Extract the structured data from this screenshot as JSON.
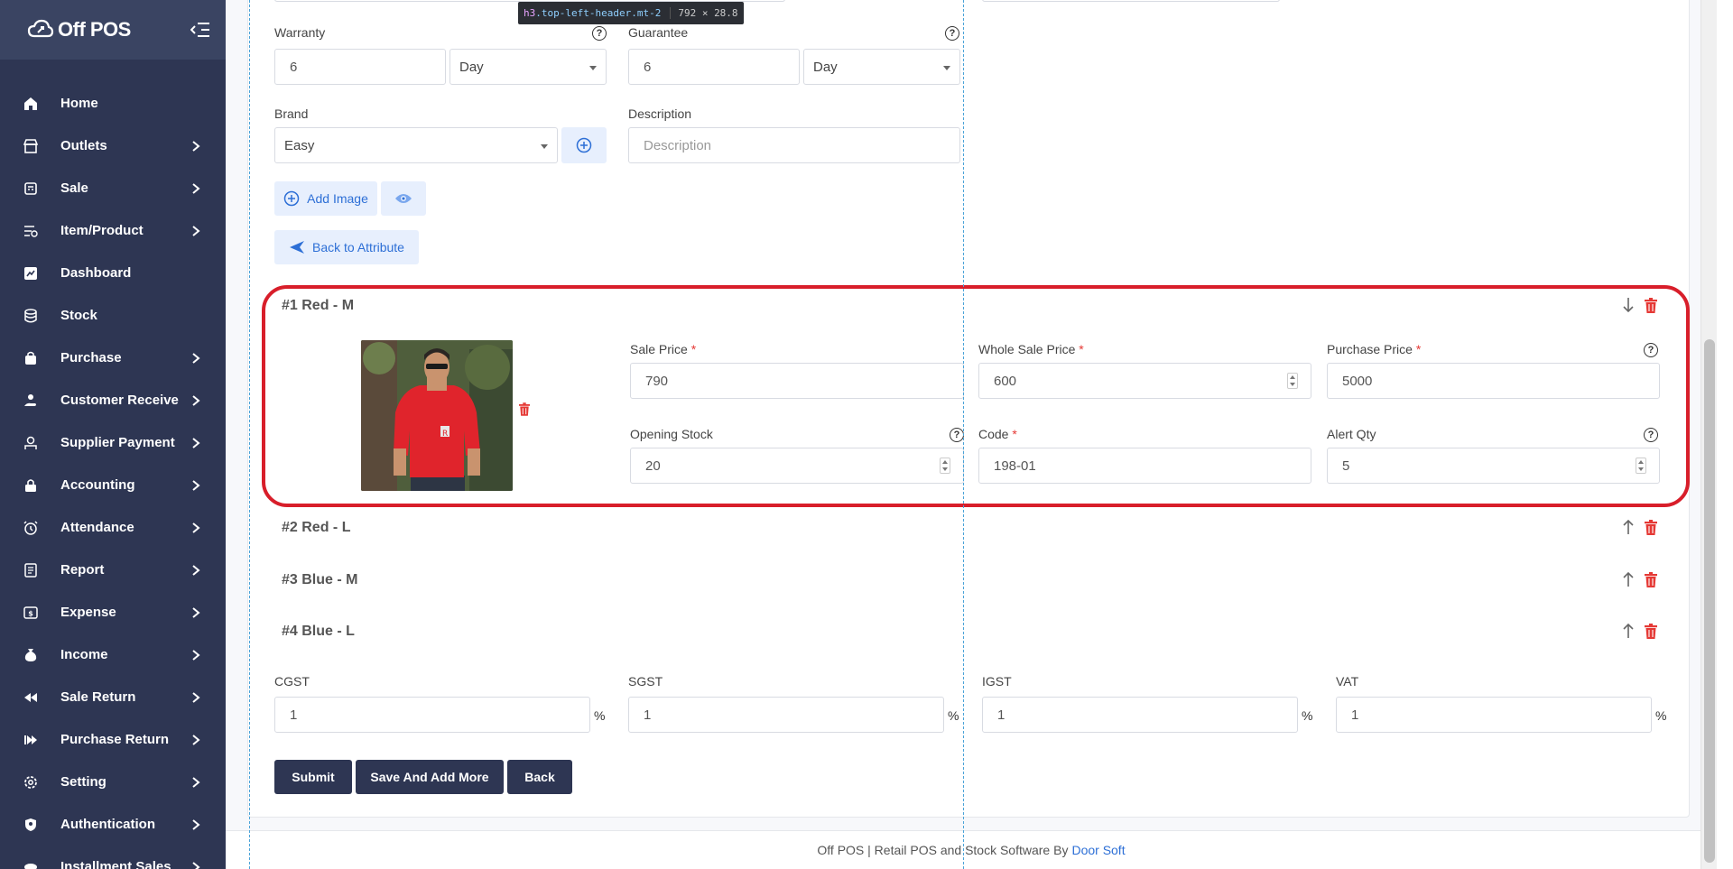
{
  "app": {
    "name": "Off POS"
  },
  "sidebar": {
    "items": [
      {
        "label": "Home",
        "icon": "home-icon",
        "has_children": false
      },
      {
        "label": "Outlets",
        "icon": "store-icon",
        "has_children": true
      },
      {
        "label": "Sale",
        "icon": "register-icon",
        "has_children": true
      },
      {
        "label": "Item/Product",
        "icon": "list-filter-icon",
        "has_children": true
      },
      {
        "label": "Dashboard",
        "icon": "chart-icon",
        "has_children": false
      },
      {
        "label": "Stock",
        "icon": "database-icon",
        "has_children": false
      },
      {
        "label": "Purchase",
        "icon": "bag-icon",
        "has_children": true
      },
      {
        "label": "Customer Receive",
        "icon": "user-hand-icon",
        "has_children": true
      },
      {
        "label": "Supplier Payment",
        "icon": "wallet-icon",
        "has_children": true
      },
      {
        "label": "Accounting",
        "icon": "lock-icon",
        "has_children": true
      },
      {
        "label": "Attendance",
        "icon": "alarm-clock-icon",
        "has_children": true
      },
      {
        "label": "Report",
        "icon": "document-icon",
        "has_children": true
      },
      {
        "label": "Expense",
        "icon": "money-icon",
        "has_children": true
      },
      {
        "label": "Income",
        "icon": "money-bag-icon",
        "has_children": true
      },
      {
        "label": "Sale Return",
        "icon": "rewind-icon",
        "has_children": true
      },
      {
        "label": "Purchase Return",
        "icon": "forward-icon",
        "has_children": true
      },
      {
        "label": "Setting",
        "icon": "gear-icon",
        "has_children": true
      },
      {
        "label": "Authentication",
        "icon": "shield-icon",
        "has_children": true
      },
      {
        "label": "Installment Sales",
        "icon": "layers-icon",
        "has_children": true
      }
    ]
  },
  "devtools": {
    "tag": "h3",
    "classes": ".top-left-header.mt-2",
    "dimensions": "792 × 28.8"
  },
  "form": {
    "warranty": {
      "label": "Warranty",
      "value": "6",
      "unit": "Day"
    },
    "guarantee": {
      "label": "Guarantee",
      "value": "6",
      "unit": "Day"
    },
    "brand": {
      "label": "Brand",
      "value": "Easy"
    },
    "description": {
      "label": "Description",
      "placeholder": "Description"
    },
    "add_image_label": "Add Image",
    "back_to_attribute_label": "Back to Attribute"
  },
  "variants": [
    {
      "title": "#1 Red - M",
      "expanded": true,
      "sale_price": {
        "label": "Sale Price",
        "value": "790"
      },
      "whole_sale_price": {
        "label": "Whole Sale Price",
        "value": "600"
      },
      "purchase_price": {
        "label": "Purchase Price",
        "value": "5000"
      },
      "opening_stock": {
        "label": "Opening Stock",
        "value": "20"
      },
      "code": {
        "label": "Code",
        "value": "198-01"
      },
      "alert_qty": {
        "label": "Alert Qty",
        "value": "5"
      }
    },
    {
      "title": "#2 Red - L",
      "expanded": false
    },
    {
      "title": "#3 Blue - M",
      "expanded": false
    },
    {
      "title": "#4 Blue - L",
      "expanded": false
    }
  ],
  "taxes": [
    {
      "label": "CGST",
      "value": "1",
      "unit": "%"
    },
    {
      "label": "SGST",
      "value": "1",
      "unit": "%"
    },
    {
      "label": "IGST",
      "value": "1",
      "unit": "%"
    },
    {
      "label": "VAT",
      "value": "1",
      "unit": "%"
    }
  ],
  "actions": {
    "submit": "Submit",
    "save_add_more": "Save And Add More",
    "back": "Back"
  },
  "footer": {
    "text": "Off POS | Retail POS and Stock Software By",
    "link": "Door Soft"
  },
  "colors": {
    "sidebar": "#2e3653",
    "accent": "#2d6fd6",
    "danger": "#e53935",
    "highlight": "#d81e2a"
  }
}
